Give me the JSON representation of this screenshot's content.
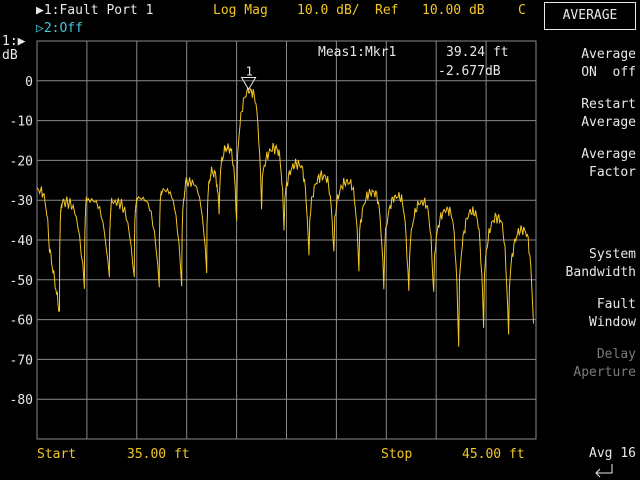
{
  "header": {
    "trace1": "1:Fault Port 1",
    "format": "Log Mag",
    "scale": "10.0 dB/",
    "ref_label": "Ref",
    "ref_value": "10.00 dB",
    "cal_flag": "C",
    "trace2": "2:Off",
    "trace_marker": "1:",
    "unit": "dB"
  },
  "marker_readout": {
    "label": "Meas1:Mkr1",
    "distance": "39.24 ft",
    "value": "-2.677dB",
    "marker_number": "1"
  },
  "footer": {
    "start_label": "Start",
    "start_value": "35.00 ft",
    "stop_label": "Stop",
    "stop_value": "45.00 ft"
  },
  "softkeys": {
    "title": "AVERAGE",
    "keys": [
      {
        "line1": "Average",
        "line2": "ON  off",
        "enabled": true
      },
      {
        "line1": "Restart",
        "line2": "Average",
        "enabled": true
      },
      {
        "line1": "Average",
        "line2": "Factor",
        "enabled": true
      },
      {
        "line1": "System",
        "line2": "Bandwidth",
        "enabled": true
      },
      {
        "line1": "Fault",
        "line2": "Window",
        "enabled": true
      },
      {
        "line1": "Delay",
        "line2": "Aperture",
        "enabled": false
      }
    ],
    "status": "Avg 16",
    "return_icon": "return-arrow-icon"
  },
  "colors": {
    "trace": "#f2c624",
    "grid": "#8a8a8a",
    "background": "#000000"
  },
  "chart_data": {
    "type": "line",
    "xlabel": "",
    "ylabel": "dB",
    "xlim": [
      35.0,
      45.0
    ],
    "ylim": [
      -90,
      10
    ],
    "yticks": [
      0,
      -10,
      -20,
      -30,
      -40,
      -50,
      -60,
      -70,
      -80
    ],
    "grid": true,
    "series": [
      {
        "peaks": [
          {
            "x": 35.0,
            "y": -27.5
          },
          {
            "x": 35.5,
            "y": -30.5
          },
          {
            "x": 36.0,
            "y": -30.0
          },
          {
            "x": 36.5,
            "y": -30.5
          },
          {
            "x": 37.0,
            "y": -29.5
          },
          {
            "x": 37.5,
            "y": -27.5
          },
          {
            "x": 38.0,
            "y": -25.5
          },
          {
            "x": 38.5,
            "y": -23.0
          },
          {
            "x": 38.8,
            "y": -17.0
          },
          {
            "x": 39.24,
            "y": -2.677
          },
          {
            "x": 39.75,
            "y": -17.0
          },
          {
            "x": 40.2,
            "y": -21.0
          },
          {
            "x": 40.7,
            "y": -24.0
          },
          {
            "x": 41.2,
            "y": -25.5
          },
          {
            "x": 41.7,
            "y": -28.0
          },
          {
            "x": 42.2,
            "y": -29.0
          },
          {
            "x": 42.7,
            "y": -30.5
          },
          {
            "x": 43.2,
            "y": -32.5
          },
          {
            "x": 43.7,
            "y": -33.0
          },
          {
            "x": 44.2,
            "y": -34.5
          },
          {
            "x": 44.7,
            "y": -37.5
          }
        ],
        "nulls": [
          {
            "x": 35.25,
            "y": -42.0
          },
          {
            "x": 35.45,
            "y": -58.0
          },
          {
            "x": 35.95,
            "y": -52.0
          },
          {
            "x": 36.45,
            "y": -50.0
          },
          {
            "x": 36.95,
            "y": -50.0
          },
          {
            "x": 37.45,
            "y": -51.0
          },
          {
            "x": 37.9,
            "y": -51.0
          },
          {
            "x": 38.4,
            "y": -47.0
          },
          {
            "x": 38.65,
            "y": -34.0
          },
          {
            "x": 39.0,
            "y": -35.0
          },
          {
            "x": 39.5,
            "y": -31.0
          },
          {
            "x": 39.95,
            "y": -37.0
          },
          {
            "x": 40.45,
            "y": -44.0
          },
          {
            "x": 40.95,
            "y": -43.0
          },
          {
            "x": 41.45,
            "y": -47.0
          },
          {
            "x": 41.95,
            "y": -52.0
          },
          {
            "x": 42.45,
            "y": -54.0
          },
          {
            "x": 42.95,
            "y": -54.0
          },
          {
            "x": 43.45,
            "y": -66.0
          },
          {
            "x": 43.95,
            "y": -61.0
          },
          {
            "x": 44.45,
            "y": -64.0
          },
          {
            "x": 44.95,
            "y": -61.0
          }
        ]
      }
    ],
    "marker": {
      "x": 39.24,
      "y": -2.677
    }
  }
}
